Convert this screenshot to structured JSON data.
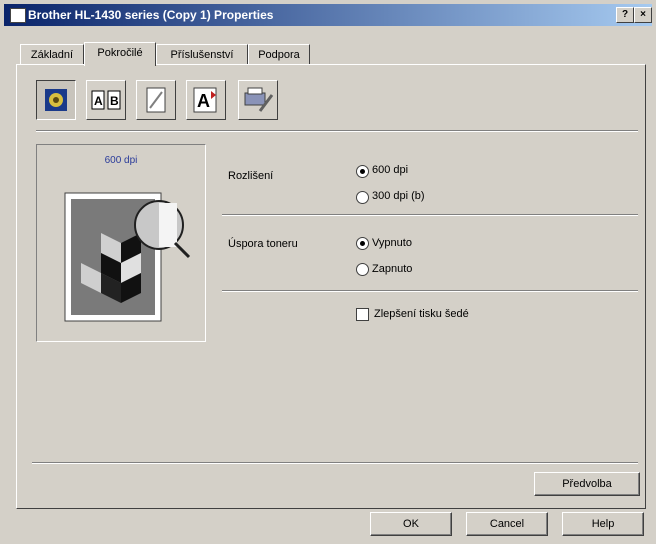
{
  "window": {
    "title": "Brother HL-1430 series (Copy 1) Properties",
    "help_btn": "?",
    "close_btn": "×"
  },
  "tabs": [
    {
      "label": "Základní"
    },
    {
      "label": "Pokročilé"
    },
    {
      "label": "Příslušenství"
    },
    {
      "label": "Podpora"
    }
  ],
  "toolbar": {
    "icons": [
      "quality-icon",
      "duplex-icon",
      "watermark-icon",
      "font-icon",
      "device-options-icon"
    ],
    "font_label": "A"
  },
  "preview": {
    "resolution_label": "600 dpi"
  },
  "resolution": {
    "label": "Rozlišení",
    "opt600": "600 dpi",
    "opt300": "300 dpi (b)",
    "selected": "600 dpi"
  },
  "toner_save": {
    "label": "Úspora toneru",
    "opt_off": "Vypnuto",
    "opt_on": "Zapnuto",
    "selected": "Vypnuto"
  },
  "improve": {
    "label": "Zlepšení tisku šedé",
    "checked": false
  },
  "buttons": {
    "default": "Předvolba",
    "ok": "OK",
    "cancel": "Cancel",
    "help": "Help"
  }
}
